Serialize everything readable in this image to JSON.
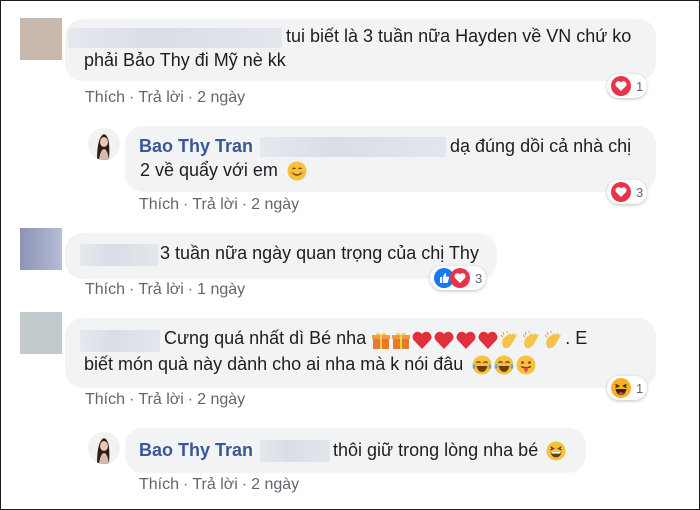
{
  "colors": {
    "author": "#385898",
    "bubble": "#f2f3f5",
    "action": "#606770",
    "love": "#e8344a",
    "like": "#1877f2",
    "haha": "#f7b125"
  },
  "comments": [
    {
      "text_line1": "tui biết là 3 tuần nữa Hayden về VN chứ ko",
      "text_line2": "phải Bảo Thy đi Mỹ nè kk",
      "like": "Thích",
      "reply": "Trả lời",
      "time": "2 ngày",
      "reaction": {
        "icon": "love-icon",
        "count": "1"
      }
    },
    {
      "author": "Bao Thy Tran",
      "text_line1": "dạ đúng dồi cả nhà chị",
      "text_line2": "2 về quẩy với em",
      "like": "Thích",
      "reply": "Trả lời",
      "time": "2 ngày",
      "reaction": {
        "icon": "love-icon",
        "count": "3"
      }
    },
    {
      "text_line1": "3 tuần nữa ngày quan trọng của chị Thy",
      "like": "Thích",
      "reply": "Trả lời",
      "time": "1 ngày",
      "reaction": {
        "icon": "like-love-icons",
        "count": "3"
      }
    },
    {
      "text_line1": "Cưng quá nhất dì Bé nha",
      "text_line1_end": ". E",
      "text_line2": "biết món quà này dành cho ai nha mà k nói đâu",
      "like": "Thích",
      "reply": "Trả lời",
      "time": "2 ngày",
      "reaction": {
        "icon": "haha-icon",
        "count": "1"
      }
    },
    {
      "author": "Bao Thy Tran",
      "text_line1": "thôi giữ trong lòng nha bé",
      "like": "Thích",
      "reply": "Trả lời",
      "time": "2 ngày"
    }
  ]
}
